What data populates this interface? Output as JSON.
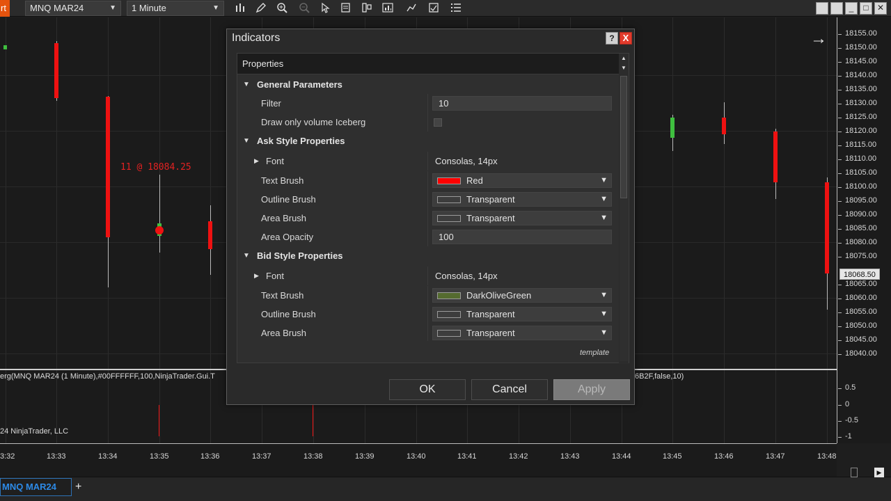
{
  "toolbar": {
    "start_label": "rt",
    "instrument": "MNQ MAR24",
    "interval": "1 Minute",
    "icons": [
      "bar-chart-icon",
      "pencil-icon",
      "zoom-in-icon",
      "zoom-out-icon",
      "pointer-icon",
      "data-box-icon",
      "drawing-tools-icon",
      "strategies-icon",
      "chart-trader-icon",
      "properties-icon",
      "indicators-icon"
    ]
  },
  "window_buttons": [
    "□",
    "_",
    "□",
    "X"
  ],
  "dialog": {
    "title": "Indicators",
    "help": "?",
    "close": "X",
    "properties_header": "Properties",
    "template_link": "template",
    "buttons": {
      "ok": "OK",
      "cancel": "Cancel",
      "apply": "Apply"
    },
    "sections": {
      "general": {
        "label": "General Parameters",
        "filter_label": "Filter",
        "filter_value": "10",
        "draw_iceberg_label": "Draw only volume Iceberg"
      },
      "ask": {
        "label": "Ask Style Properties",
        "font_label": "Font",
        "font_value": "Consolas, 14px",
        "text_brush_label": "Text Brush",
        "text_brush_value": "Red",
        "text_brush_color": "#ff0000",
        "outline_brush_label": "Outline Brush",
        "outline_brush_value": "Transparent",
        "area_brush_label": "Area Brush",
        "area_brush_value": "Transparent",
        "area_opacity_label": "Area Opacity",
        "area_opacity_value": "100"
      },
      "bid": {
        "label": "Bid Style Properties",
        "font_label": "Font",
        "font_value": "Consolas, 14px",
        "text_brush_label": "Text Brush",
        "text_brush_value": "DarkOliveGreen",
        "text_brush_color": "#556b2f",
        "outline_brush_label": "Outline Brush",
        "outline_brush_value": "Transparent",
        "area_brush_label": "Area Brush",
        "area_brush_value": "Transparent"
      }
    }
  },
  "chart": {
    "annotation": "11 @ 18084.25",
    "indicator_label_left": "erg(MNQ MAR24 (1 Minute),#00FFFFFF,100,NinjaTrader.Gui.T",
    "indicator_label_right": "6B2F,false,10)",
    "copyright": "24 NinjaTrader, LLC",
    "current_price": "18068.50",
    "price_ticks": [
      "18155.00",
      "18150.00",
      "18145.00",
      "18140.00",
      "18135.00",
      "18130.00",
      "18125.00",
      "18120.00",
      "18115.00",
      "18110.00",
      "18105.00",
      "18100.00",
      "18095.00",
      "18090.00",
      "18085.00",
      "18080.00",
      "18075.00",
      "18065.00",
      "18060.00",
      "18055.00",
      "18050.00",
      "18045.00",
      "18040.00"
    ],
    "lower_ticks": [
      "0.5",
      "0",
      "-0.5",
      "-1"
    ],
    "time_ticks": [
      "3:32",
      "13:33",
      "13:34",
      "13:35",
      "13:36",
      "13:37",
      "13:38",
      "13:39",
      "13:40",
      "13:41",
      "13:42",
      "13:43",
      "13:44",
      "13:45",
      "13:46",
      "13:47",
      "13:48"
    ]
  },
  "bottom_tabs": {
    "instrument_tab": "MNQ MAR24",
    "add_tab": "+"
  }
}
